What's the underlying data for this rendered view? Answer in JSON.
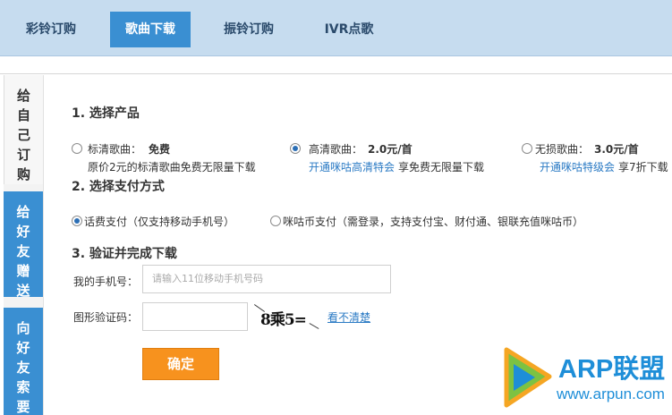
{
  "nav": {
    "tabs": [
      {
        "label": "彩铃订购"
      },
      {
        "label": "歌曲下载"
      },
      {
        "label": "振铃订购"
      },
      {
        "label": "IVR点歌"
      }
    ]
  },
  "side": {
    "self": [
      "给",
      "自",
      "己",
      "订",
      "购"
    ],
    "gift": [
      "给",
      "好",
      "友",
      "赠",
      "送"
    ],
    "ask": [
      "向",
      "好",
      "友",
      "索",
      "要"
    ]
  },
  "step1": {
    "title": "1. 选择产品",
    "standard": {
      "label": "标清歌曲：",
      "price": "免费",
      "desc": "原价2元的标清歌曲免费无限量下载"
    },
    "hd": {
      "label": "高清歌曲：",
      "price": "2.0元/首",
      "link": "开通咪咕高清特会",
      "desc": "享免费无限量下载"
    },
    "lossless": {
      "label": "无损歌曲：",
      "price": "3.0元/首",
      "link": "开通咪咕特级会",
      "desc": "享7折下载"
    }
  },
  "step2": {
    "title": "2. 选择支付方式",
    "phone_pay": "话费支付（仅支持移动手机号）",
    "migu_pay": "咪咕币支付（需登录，支持支付宝、财付通、银联充值咪咕币）"
  },
  "step3": {
    "title": "3. 验证并完成下载",
    "phone_label": "我的手机号：",
    "phone_placeholder": "请输入11位移动手机号码",
    "code_label": "图形验证码：",
    "captcha_text": "8乘5=",
    "refresh_link": "看不清楚",
    "submit": "确定"
  },
  "watermark": {
    "name": "ARP联盟",
    "url": "www.arpun.com"
  },
  "colors": {
    "accent": "#3a8fd2",
    "nav_bg": "#c6dcef",
    "button": "#f7921e",
    "link": "#2a7ac4"
  }
}
